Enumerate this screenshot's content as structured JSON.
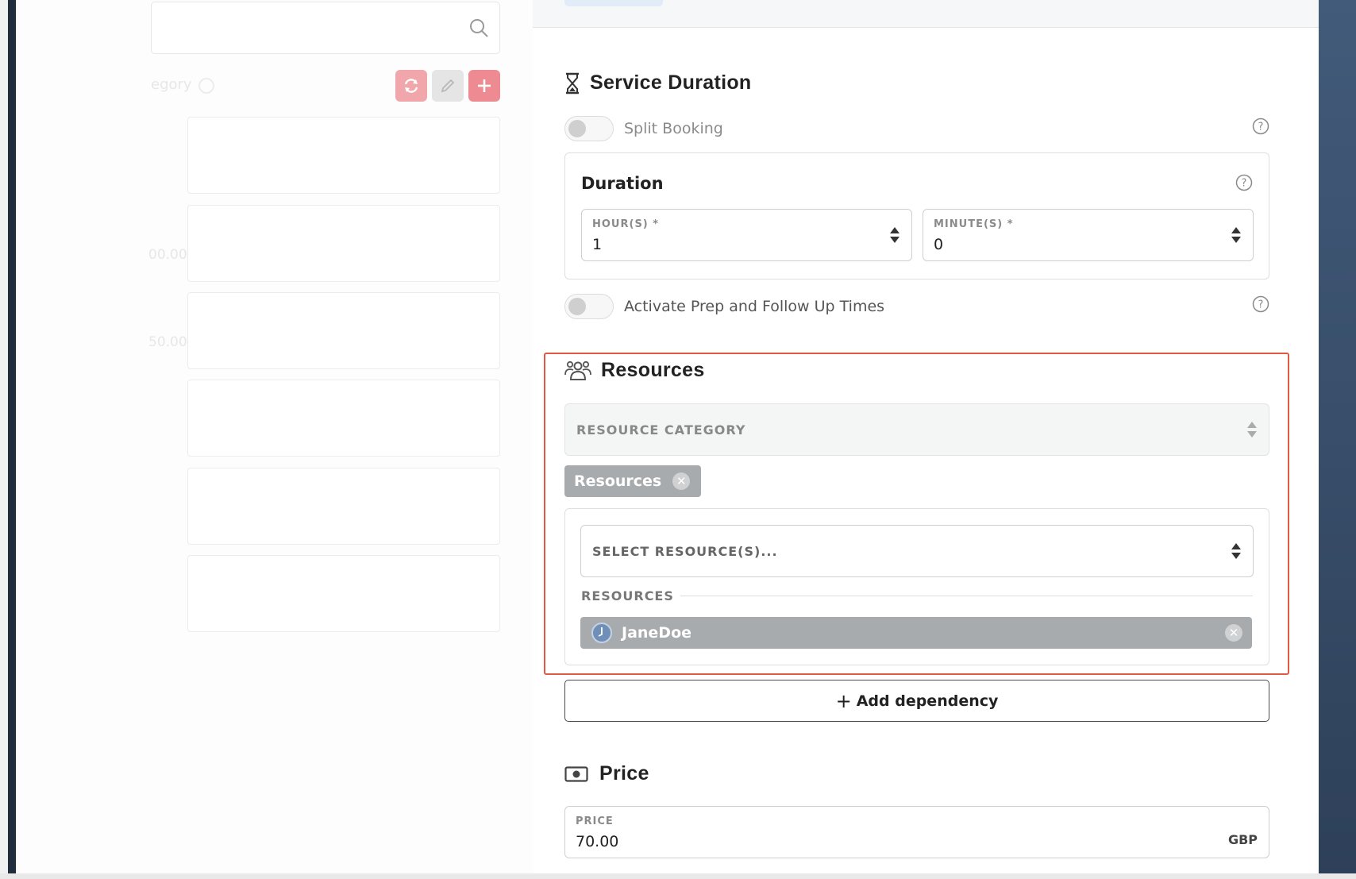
{
  "left_panel": {
    "faded_label": "egory",
    "faded_price_1": "00.00",
    "faded_price_2": "50.00"
  },
  "service_duration": {
    "title": "Service Duration",
    "split_booking_label": "Split Booking",
    "duration": {
      "title": "Duration",
      "hours_label": "HOUR(S) *",
      "hours_value": "1",
      "minutes_label": "MINUTE(S) *",
      "minutes_value": "0"
    },
    "prep_label": "Activate Prep and Follow Up Times"
  },
  "resources": {
    "title": "Resources",
    "category_placeholder": "RESOURCE CATEGORY",
    "category_chip": "Resources",
    "select_placeholder": "SELECT RESOURCE(S)...",
    "group_label": "RESOURCES",
    "selected": [
      {
        "name": "JaneDoe"
      }
    ]
  },
  "add_dependency": {
    "icon": "+",
    "label": "Add dependency"
  },
  "price": {
    "title": "Price",
    "field_label": "PRICE",
    "value": "70.00",
    "currency": "GBP"
  },
  "colors": {
    "highlight": "#e05a43",
    "chip": "#a8abad",
    "accent_red": "#ee8a92"
  }
}
